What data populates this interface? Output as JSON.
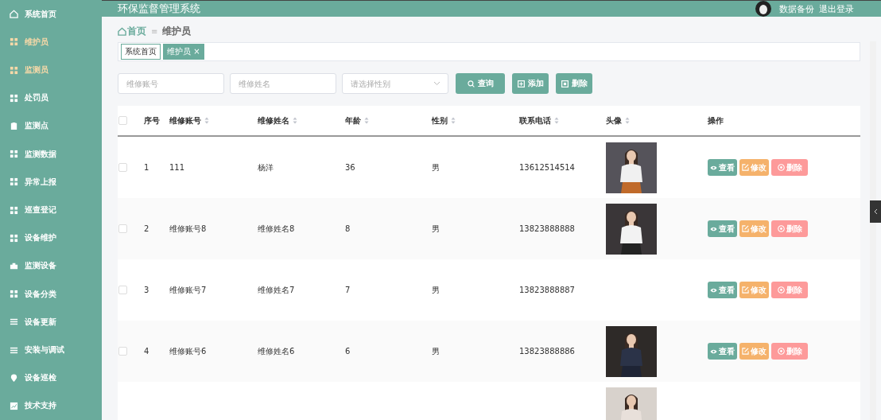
{
  "sidebar": {
    "items": [
      {
        "label": "系统首页",
        "kind": "home",
        "selected": false
      },
      {
        "label": "维护员",
        "kind": "grid",
        "selected": true
      },
      {
        "label": "监测员",
        "kind": "grid",
        "selected": true
      },
      {
        "label": "处罚员",
        "kind": "grid",
        "selected": false
      },
      {
        "label": "监测点",
        "kind": "clipboard",
        "selected": false
      },
      {
        "label": "监测数据",
        "kind": "grid",
        "selected": false
      },
      {
        "label": "异常上报",
        "kind": "grid",
        "selected": false
      },
      {
        "label": "巡查登记",
        "kind": "grid",
        "selected": false
      },
      {
        "label": "设备维护",
        "kind": "grid",
        "selected": false
      },
      {
        "label": "监测设备",
        "kind": "briefcase",
        "selected": false
      },
      {
        "label": "设备分类",
        "kind": "grid",
        "selected": false
      },
      {
        "label": "设备更新",
        "kind": "list",
        "selected": false
      },
      {
        "label": "安装与调试",
        "kind": "list",
        "selected": false
      },
      {
        "label": "设备巡检",
        "kind": "pin",
        "selected": false
      },
      {
        "label": "技术支持",
        "kind": "chart",
        "selected": false
      }
    ]
  },
  "header": {
    "title": "环保监督管理系统",
    "links": [
      "数据备份",
      "退出登录"
    ]
  },
  "breadcrumb": {
    "home": "首页",
    "separator": "≡",
    "current": "维护员"
  },
  "tags": [
    {
      "label": "系统首页",
      "selected": false
    },
    {
      "label": "维护员",
      "selected": true,
      "close": "×"
    }
  ],
  "search": {
    "fields": [
      {
        "kind": "input",
        "placeholder": "维修账号"
      },
      {
        "kind": "input",
        "placeholder": "维修姓名"
      },
      {
        "kind": "select",
        "placeholder": "请选择性别"
      }
    ],
    "buttons": [
      {
        "kind": "search",
        "label": "查询"
      },
      {
        "kind": "add",
        "label": "添加"
      },
      {
        "kind": "delete",
        "label": "删除"
      }
    ]
  },
  "table": {
    "select_all_checked": false,
    "columns": [
      {
        "label": "序号",
        "sortable": false
      },
      {
        "label": "维修账号",
        "sortable": true
      },
      {
        "label": "维修姓名",
        "sortable": true
      },
      {
        "label": "年龄",
        "sortable": true
      },
      {
        "label": "性别",
        "sortable": true
      },
      {
        "label": "联系电话",
        "sortable": true
      },
      {
        "label": "头像",
        "sortable": true
      },
      {
        "label": "操作",
        "sortable": false
      }
    ],
    "rows": [
      {
        "checked": false,
        "cells": [
          "1",
          "111",
          "杨洋",
          "36",
          "男",
          "13612514514"
        ],
        "photo": {
          "kind": "picture"
        },
        "actions": [
          {
            "kind": "view",
            "label": "查看"
          },
          {
            "kind": "edit",
            "label": "修改"
          },
          {
            "kind": "delete",
            "label": "删除"
          }
        ]
      },
      {
        "checked": false,
        "cells": [
          "2",
          "维修账号8",
          "维修姓名8",
          "8",
          "男",
          "13823888888"
        ],
        "photo": {
          "kind": "picture"
        },
        "actions": [
          {
            "kind": "view",
            "label": "查看"
          },
          {
            "kind": "edit",
            "label": "修改"
          },
          {
            "kind": "delete",
            "label": "删除"
          }
        ]
      },
      {
        "checked": false,
        "cells": [
          "3",
          "维修账号7",
          "维修姓名7",
          "7",
          "男",
          "13823888887"
        ],
        "actions": [
          {
            "kind": "view",
            "label": "查看"
          },
          {
            "kind": "edit",
            "label": "修改"
          },
          {
            "kind": "delete",
            "label": "删除"
          }
        ]
      },
      {
        "checked": false,
        "cells": [
          "4",
          "维修账号6",
          "维修姓名6",
          "6",
          "男",
          "13823888886"
        ],
        "photo": {
          "kind": "picture"
        },
        "actions": [
          {
            "kind": "view",
            "label": "查看"
          },
          {
            "kind": "edit",
            "label": "修改"
          },
          {
            "kind": "delete",
            "label": "删除"
          }
        ]
      },
      {
        "photo": {
          "kind": "picture"
        }
      }
    ]
  }
}
